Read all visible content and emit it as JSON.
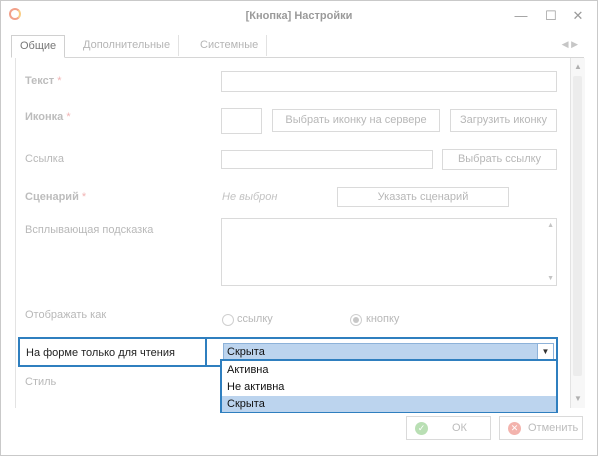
{
  "window": {
    "title": "[Кнопка] Настройки",
    "icons": {
      "app": "app-logo-icon",
      "minimize": "minimize-icon",
      "maximize": "maximize-icon",
      "close": "close-icon"
    }
  },
  "tabs": [
    {
      "label": "Общие",
      "active": true
    },
    {
      "label": "Дополнительные",
      "active": false
    },
    {
      "label": "Системные",
      "active": false
    }
  ],
  "form": {
    "text": {
      "label": "Текст",
      "required": "*",
      "value": ""
    },
    "icon": {
      "label": "Иконка",
      "required": "*",
      "choose_server": "Выбрать иконку на сервере",
      "upload": "Загрузить иконку"
    },
    "link": {
      "label": "Ссылка",
      "value": "",
      "choose": "Выбрать ссылку"
    },
    "scenario": {
      "label": "Сценарий",
      "required": "*",
      "value": "Не выброн",
      "button": "Указать сценарий"
    },
    "tooltip": {
      "label": "Всплывающая подсказка",
      "value": ""
    },
    "display_as": {
      "label": "Отображать как",
      "option_link": "ссылку",
      "option_button": "кнопку",
      "selected": "кнопку"
    },
    "readonly": {
      "label": "На форме только для чтения",
      "value": "Скрыта"
    },
    "style": {
      "label": "Стиль"
    }
  },
  "dropdown": {
    "options": [
      "Активна",
      "Не активна",
      "Скрыта"
    ],
    "selected": "Скрыта"
  },
  "footer": {
    "ok": "ОК",
    "cancel": "Отменить"
  },
  "colors": {
    "accent": "#2f7fbf",
    "selection": "#bcd4ee"
  }
}
